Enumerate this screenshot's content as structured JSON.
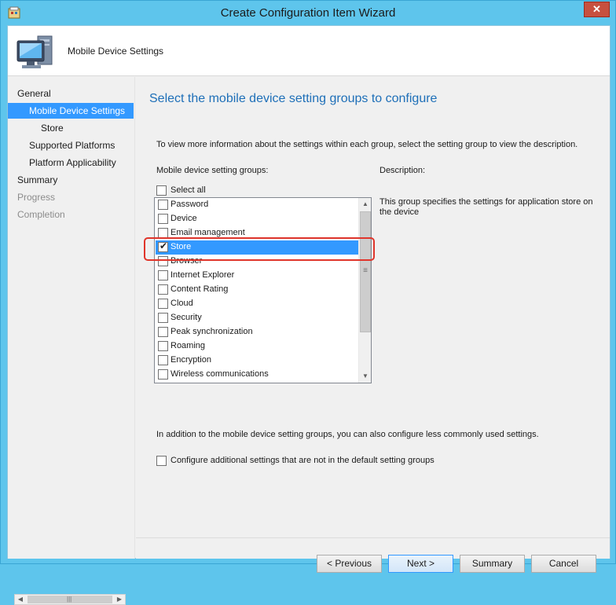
{
  "window": {
    "title": "Create Configuration Item Wizard",
    "close_label": "✕"
  },
  "header": {
    "title": "Mobile Device Settings"
  },
  "nav": {
    "items": [
      {
        "label": "General",
        "state": "normal"
      },
      {
        "label": "Mobile Device Settings",
        "state": "selected"
      },
      {
        "label": "Store",
        "state": "normal"
      },
      {
        "label": "Supported Platforms",
        "state": "normal"
      },
      {
        "label": "Platform Applicability",
        "state": "normal"
      },
      {
        "label": "Summary",
        "state": "normal"
      },
      {
        "label": "Progress",
        "state": "disabled"
      },
      {
        "label": "Completion",
        "state": "disabled"
      }
    ]
  },
  "main": {
    "heading": "Select the mobile device setting groups to configure",
    "instruction": "To view more information about the settings within each group, select the setting group to view the description.",
    "groups_label": "Mobile device setting groups:",
    "description_label": "Description:",
    "select_all_label": "Select all",
    "groups": [
      {
        "label": "Password",
        "checked": false,
        "selected": false
      },
      {
        "label": "Device",
        "checked": false,
        "selected": false
      },
      {
        "label": "Email management",
        "checked": false,
        "selected": false
      },
      {
        "label": "Store",
        "checked": true,
        "selected": true
      },
      {
        "label": "Browser",
        "checked": false,
        "selected": false
      },
      {
        "label": "Internet Explorer",
        "checked": false,
        "selected": false
      },
      {
        "label": "Content Rating",
        "checked": false,
        "selected": false
      },
      {
        "label": "Cloud",
        "checked": false,
        "selected": false
      },
      {
        "label": "Security",
        "checked": false,
        "selected": false
      },
      {
        "label": "Peak synchronization",
        "checked": false,
        "selected": false
      },
      {
        "label": "Roaming",
        "checked": false,
        "selected": false
      },
      {
        "label": "Encryption",
        "checked": false,
        "selected": false
      },
      {
        "label": "Wireless communications",
        "checked": false,
        "selected": false
      }
    ],
    "description": "This group specifies the settings for application store on the device",
    "additional_text": "In addition to the mobile device setting groups, you can also configure less commonly used settings.",
    "additional_checkbox_label": "Configure additional settings that are not in the default setting groups",
    "check_glyph": "✔"
  },
  "buttons": {
    "previous": "< Previous",
    "next": "Next >",
    "summary": "Summary",
    "cancel": "Cancel"
  },
  "colors": {
    "selection": "#3399ff",
    "heading": "#1e6fb8",
    "highlight": "#e0352b",
    "titlebar": "#5ec5ec"
  }
}
